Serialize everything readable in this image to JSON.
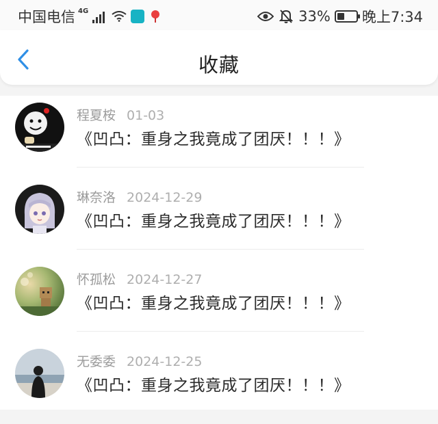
{
  "status_bar": {
    "carrier": "中国电信",
    "network": "4G",
    "battery": "33%",
    "time": "晚上7:34"
  },
  "header": {
    "title": "收藏",
    "back_icon": "chevron-left-icon"
  },
  "colors": {
    "accent": "#2f8fe6",
    "meta_text": "#9b9b9b"
  },
  "favorites": [
    {
      "user": "程夏桉",
      "date": "01-03",
      "content": "《凹凸：重身之我竟成了团厌！！！》",
      "avatar": "meme-face-avatar"
    },
    {
      "user": "琳奈洛",
      "date": "2024-12-29",
      "content": "《凹凸：重身之我竟成了团厌！！！》",
      "avatar": "anime-girl-avatar"
    },
    {
      "user": "怀孤松",
      "date": "2024-12-27",
      "content": "《凹凸：重身之我竟成了团厌！！！》",
      "avatar": "box-figure-avatar"
    },
    {
      "user": "无委委",
      "date": "2024-12-25",
      "content": "《凹凸：重身之我竟成了团厌！！！》",
      "avatar": "person-seaside-avatar"
    }
  ]
}
